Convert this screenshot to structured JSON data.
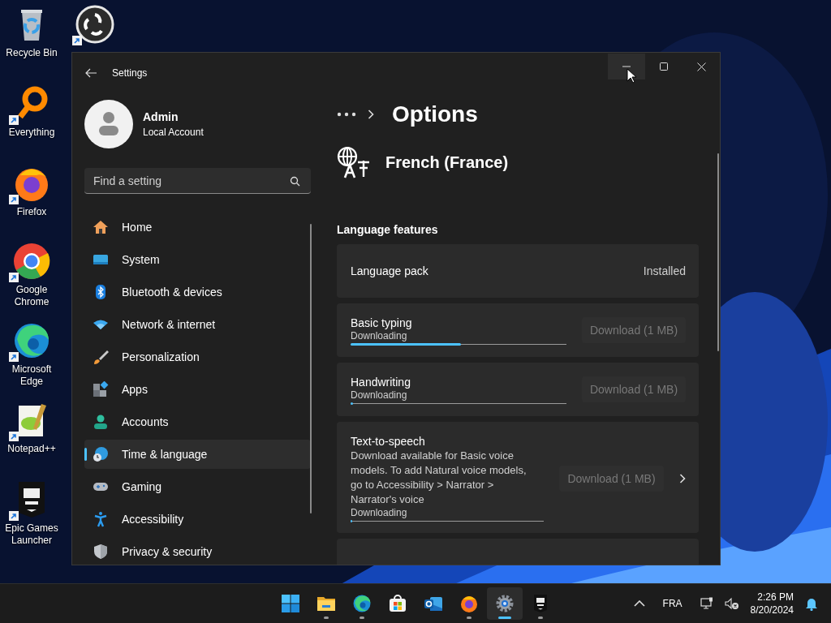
{
  "desktop_icons": [
    {
      "kind": "recycle-bin",
      "label": "Recycle Bin",
      "shortcut": false
    },
    {
      "kind": "obs",
      "shortcut": true
    },
    {
      "kind": "everything",
      "label": "Everything",
      "shortcut": true
    },
    {
      "kind": "firefox",
      "label": "Firefox",
      "shortcut": true
    },
    {
      "kind": "chrome",
      "label": "Google Chrome",
      "shortcut": true
    },
    {
      "kind": "edge",
      "label": "Microsoft Edge",
      "shortcut": true
    },
    {
      "kind": "notepad",
      "label": "Notepad++",
      "shortcut": true
    },
    {
      "kind": "epic",
      "label": "Epic Games Launcher",
      "shortcut": true
    }
  ],
  "settings_window": {
    "title": "Settings",
    "caption_buttons": [
      {
        "kind": "minimize",
        "hovered": true
      },
      {
        "kind": "maximize",
        "hovered": false
      },
      {
        "kind": "close",
        "hovered": false
      }
    ],
    "account": {
      "name": "Admin",
      "type": "Local Account"
    },
    "search": {
      "placeholder": "Find a setting"
    },
    "nav": [
      {
        "kind": "home",
        "label": "Home",
        "selected": false
      },
      {
        "kind": "system",
        "label": "System",
        "selected": false
      },
      {
        "kind": "bluetooth",
        "label": "Bluetooth & devices",
        "selected": false
      },
      {
        "kind": "network",
        "label": "Network & internet",
        "selected": false
      },
      {
        "kind": "personalization",
        "label": "Personalization",
        "selected": false
      },
      {
        "kind": "apps",
        "label": "Apps",
        "selected": false
      },
      {
        "kind": "accounts",
        "label": "Accounts",
        "selected": false
      },
      {
        "kind": "time",
        "label": "Time & language",
        "selected": true
      },
      {
        "kind": "gaming",
        "label": "Gaming",
        "selected": false
      },
      {
        "kind": "accessibility",
        "label": "Accessibility",
        "selected": false
      },
      {
        "kind": "privacy",
        "label": "Privacy & security",
        "selected": false
      }
    ],
    "page_title": "Options",
    "language": "French (France)",
    "section_title": "Language features",
    "features": [
      {
        "kind": "status",
        "title": "Language pack",
        "status": "Installed"
      },
      {
        "kind": "download",
        "title": "Basic typing",
        "progress_label": "Downloading",
        "level": 0.51,
        "button": "Download (1 MB)",
        "disabled": true,
        "chevron": false
      },
      {
        "kind": "download",
        "title": "Handwriting",
        "progress_label": "Downloading",
        "level": 0,
        "button": "Download (1 MB)",
        "disabled": true,
        "chevron": false
      },
      {
        "kind": "download",
        "title": "Text-to-speech",
        "description": "Download available for Basic voice models. To add Natural voice models, go to Accessibility > Narrator > Narrator's voice",
        "progress_label": "Downloading",
        "level": 0,
        "button": "Download (1 MB)",
        "disabled": true,
        "chevron": true
      },
      {
        "kind": "blank"
      }
    ]
  },
  "taskbar": {
    "apps": [
      {
        "kind": "start",
        "running": false,
        "selected": false
      },
      {
        "kind": "explorer",
        "running": true,
        "selected": false
      },
      {
        "kind": "edge",
        "running": true,
        "selected": false
      },
      {
        "kind": "store",
        "running": false,
        "selected": false
      },
      {
        "kind": "outlook",
        "running": false,
        "selected": false
      },
      {
        "kind": "firefox",
        "running": true,
        "selected": false
      },
      {
        "kind": "settings",
        "running": true,
        "selected": true
      },
      {
        "kind": "epic",
        "running": true,
        "selected": false
      }
    ],
    "tray": {
      "language": "FRA",
      "time": "2:26 PM",
      "date": "8/20/2024"
    }
  }
}
